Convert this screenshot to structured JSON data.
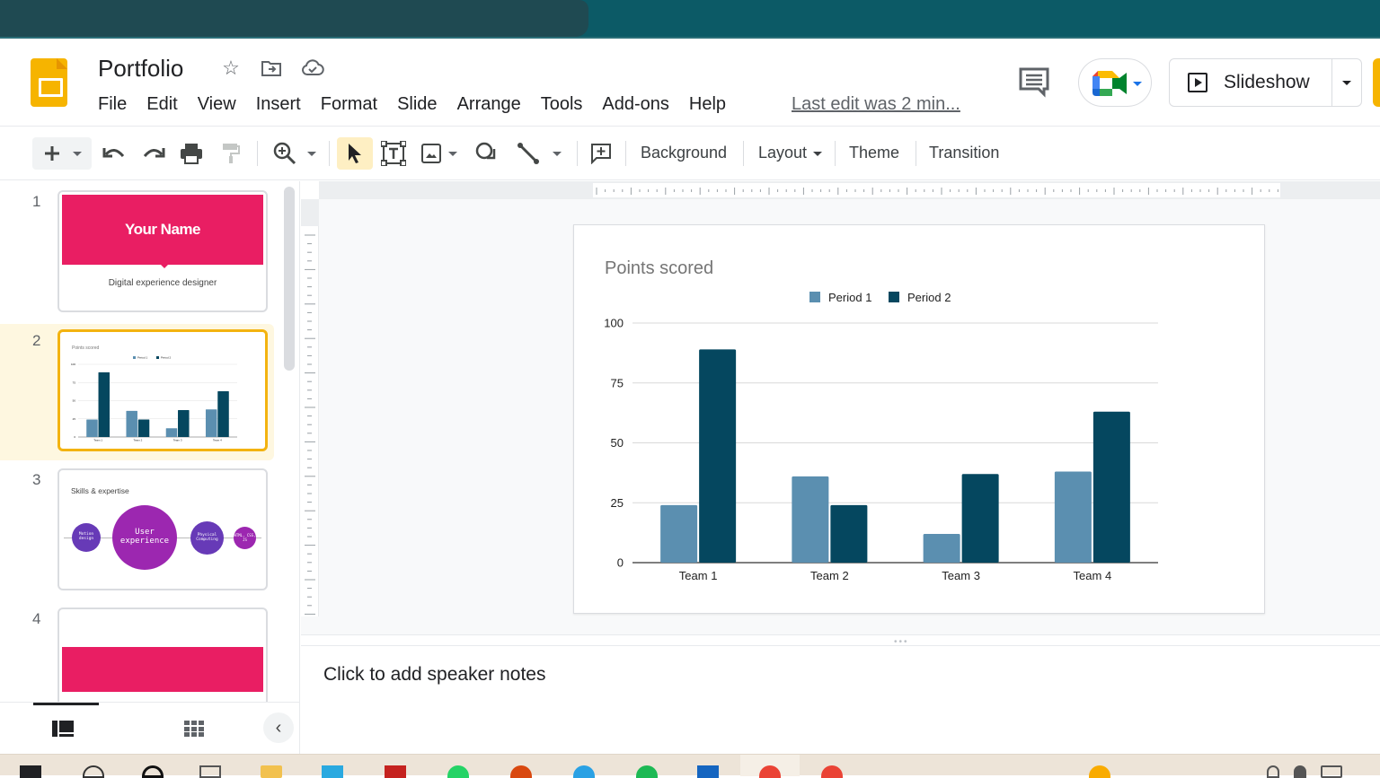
{
  "app": {
    "doc_title": "Portfolio",
    "menu": [
      "File",
      "Edit",
      "View",
      "Insert",
      "Format",
      "Slide",
      "Arrange",
      "Tools",
      "Add-ons",
      "Help"
    ],
    "last_edit": "Last edit was 2 min...",
    "slideshow_label": "Slideshow"
  },
  "toolbar": {
    "background_label": "Background",
    "layout_label": "Layout",
    "theme_label": "Theme",
    "transition_label": "Transition"
  },
  "filmstrip": {
    "slides": [
      {
        "number": "1",
        "title": "Your Name",
        "subtitle": "Digital experience designer"
      },
      {
        "number": "2",
        "title": "Points scored"
      },
      {
        "number": "3",
        "title": "Skills & expertise",
        "bubbles": [
          "Motion design",
          "User experience",
          "Physical Computing",
          "HTML, CSS, JS"
        ]
      },
      {
        "number": "4"
      }
    ],
    "selected_index": 2
  },
  "notes": {
    "placeholder": "Click to add speaker notes"
  },
  "colors": {
    "accent_pink": "#e91e63",
    "selection_yellow": "#f3b310",
    "period1": "#5b8fb0",
    "period2": "#05475f",
    "bubble_purple": "#9c27b0",
    "bubble_violet": "#673ab7"
  },
  "chart_data": {
    "type": "bar",
    "title": "Points scored",
    "categories": [
      "Team 1",
      "Team 2",
      "Team 3",
      "Team 4"
    ],
    "series": [
      {
        "name": "Period 1",
        "color": "#5b8fb0",
        "values": [
          24,
          36,
          12,
          38
        ]
      },
      {
        "name": "Period 2",
        "color": "#05475f",
        "values": [
          89,
          24,
          37,
          63
        ]
      }
    ],
    "xlabel": "",
    "ylabel": "",
    "ylim": [
      0,
      100
    ],
    "yticks": [
      0,
      25,
      50,
      75,
      100
    ],
    "grid": true,
    "legend": "top-center"
  }
}
